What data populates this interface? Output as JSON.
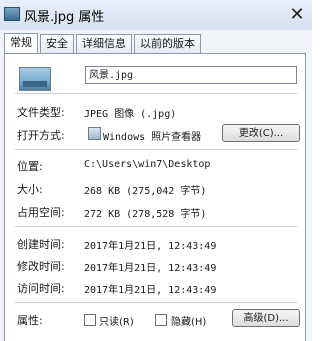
{
  "title_bar": {
    "title": "风景.jpg 属性",
    "close_glyph": "✕"
  },
  "tabs": [
    {
      "label": "常规",
      "active": true
    },
    {
      "label": "安全",
      "active": false
    },
    {
      "label": "详细信息",
      "active": false
    },
    {
      "label": "以前的版本",
      "active": false
    }
  ],
  "general": {
    "file_name": "风景.jpg",
    "file_type": {
      "label": "文件类型:",
      "value": "JPEG 图像 (.jpg)"
    },
    "opens_with": {
      "label": "打开方式:",
      "value": "Windows 照片查看器",
      "change_button": "更改(C)..."
    },
    "location": {
      "label": "位置:",
      "value": "C:\\Users\\win7\\Desktop"
    },
    "size": {
      "label": "大小:",
      "value": "268 KB (275,042 字节)"
    },
    "size_on_disk": {
      "label": "占用空间:",
      "value": "272 KB (278,528 字节)"
    },
    "created": {
      "label": "创建时间:",
      "value": "2017年1月21日, 12:43:49"
    },
    "modified": {
      "label": "修改时间:",
      "value": "2017年1月21日, 12:43:49"
    },
    "accessed": {
      "label": "访问时间:",
      "value": "2017年1月21日, 12:43:49"
    },
    "attributes": {
      "label": "属性:",
      "readonly_label": "只读(R)",
      "readonly_checked": false,
      "hidden_label": "隐藏(H)",
      "hidden_checked": false,
      "advanced_button": "高级(D)..."
    }
  }
}
